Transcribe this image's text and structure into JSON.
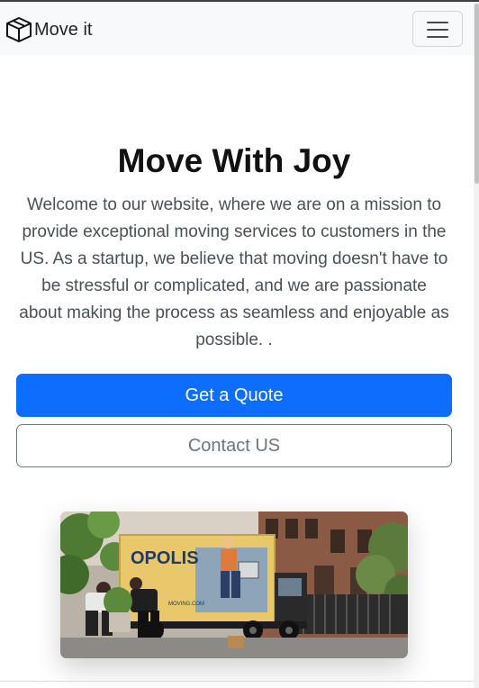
{
  "navbar": {
    "brand_icon": "box-icon",
    "brand_text": "Move it",
    "toggler_icon": "hamburger-menu-icon"
  },
  "hero": {
    "title": "Move With Joy",
    "text": "Welcome to our website, where we are on a mission to provide exceptional moving services to customers in the US. As a startup, we believe that moving doesn't have to be stressful or complicated, and we are passionate about making the process as seamless and enjoyable as possible. ."
  },
  "buttons": {
    "quote_label": "Get a Quote",
    "contact_label": "Contact US"
  },
  "photo": {
    "truck_text": "OPOLIS",
    "truck_url": "MOVING.COM"
  },
  "colors": {
    "primary": "#0d6efd",
    "secondary": "#6c757d",
    "navbar_bg": "#f8f9fa"
  }
}
